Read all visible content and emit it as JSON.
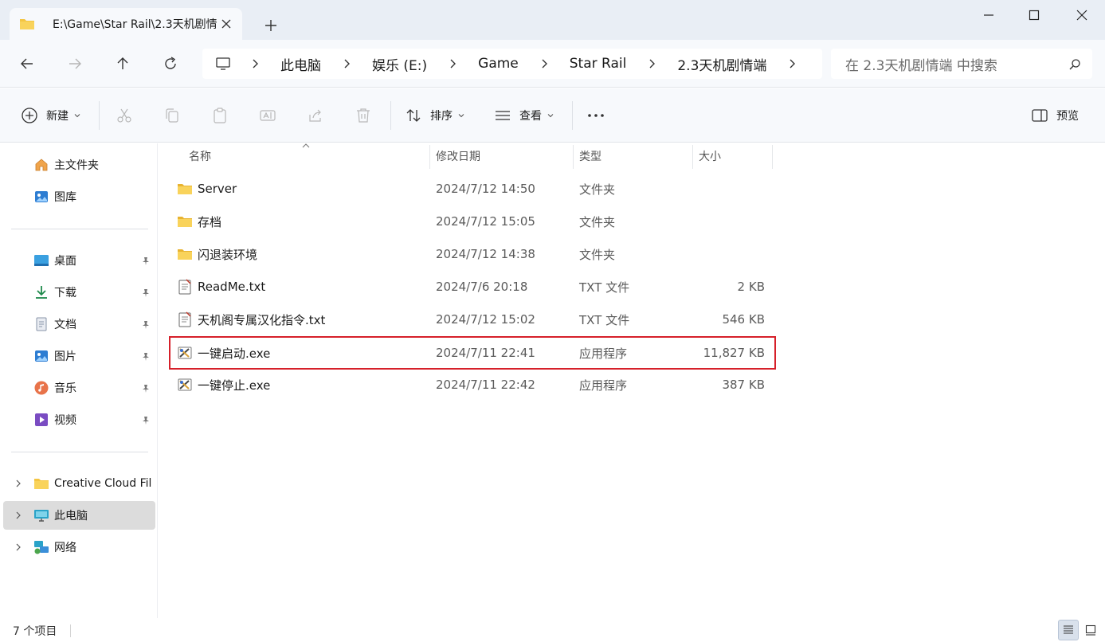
{
  "tab": {
    "title": "E:\\Game\\Star Rail\\2.3天机剧情"
  },
  "address": {
    "crumbs": [
      "此电脑",
      "娱乐 (E:)",
      "Game",
      "Star Rail",
      "2.3天机剧情端"
    ]
  },
  "search": {
    "placeholder": "在 2.3天机剧情端 中搜索"
  },
  "toolbar": {
    "new_label": "新建",
    "sort_label": "排序",
    "view_label": "查看",
    "preview_label": "预览"
  },
  "sidebar": {
    "items": [
      {
        "label": "主文件夹",
        "icon": "home-icon"
      },
      {
        "label": "图库",
        "icon": "gallery-icon"
      },
      {
        "label": "桌面",
        "icon": "desktop-icon"
      },
      {
        "label": "下载",
        "icon": "download-icon"
      },
      {
        "label": "文档",
        "icon": "document-icon"
      },
      {
        "label": "图片",
        "icon": "pictures-icon"
      },
      {
        "label": "音乐",
        "icon": "music-icon"
      },
      {
        "label": "视频",
        "icon": "video-icon"
      },
      {
        "label": "Creative Cloud Fil",
        "icon": "folder-icon"
      },
      {
        "label": "此电脑",
        "icon": "computer-icon"
      },
      {
        "label": "网络",
        "icon": "network-icon"
      }
    ]
  },
  "columns": {
    "name": "名称",
    "date": "修改日期",
    "type": "类型",
    "size": "大小"
  },
  "files": [
    {
      "name": "Server",
      "date": "2024/7/12 14:50",
      "type": "文件夹",
      "size": "",
      "icon": "folder-icon"
    },
    {
      "name": "存档",
      "date": "2024/7/12 15:05",
      "type": "文件夹",
      "size": "",
      "icon": "folder-icon"
    },
    {
      "name": "闪退装环境",
      "date": "2024/7/12 14:38",
      "type": "文件夹",
      "size": "",
      "icon": "folder-icon"
    },
    {
      "name": "ReadMe.txt",
      "date": "2024/7/6 20:18",
      "type": "TXT 文件",
      "size": "2 KB",
      "icon": "text-file-icon"
    },
    {
      "name": "天机阁专属汉化指令.txt",
      "date": "2024/7/12 15:02",
      "type": "TXT 文件",
      "size": "546 KB",
      "icon": "text-file-icon"
    },
    {
      "name": "一键启动.exe",
      "date": "2024/7/11 22:41",
      "type": "应用程序",
      "size": "11,827 KB",
      "icon": "exe-icon",
      "highlighted": true
    },
    {
      "name": "一键停止.exe",
      "date": "2024/7/11 22:42",
      "type": "应用程序",
      "size": "387 KB",
      "icon": "exe-icon"
    }
  ],
  "status": {
    "count_text": "7 个项目"
  },
  "colors": {
    "highlight": "#d6202a",
    "folder": "#f4c542",
    "selected": "#dcdcdc"
  }
}
